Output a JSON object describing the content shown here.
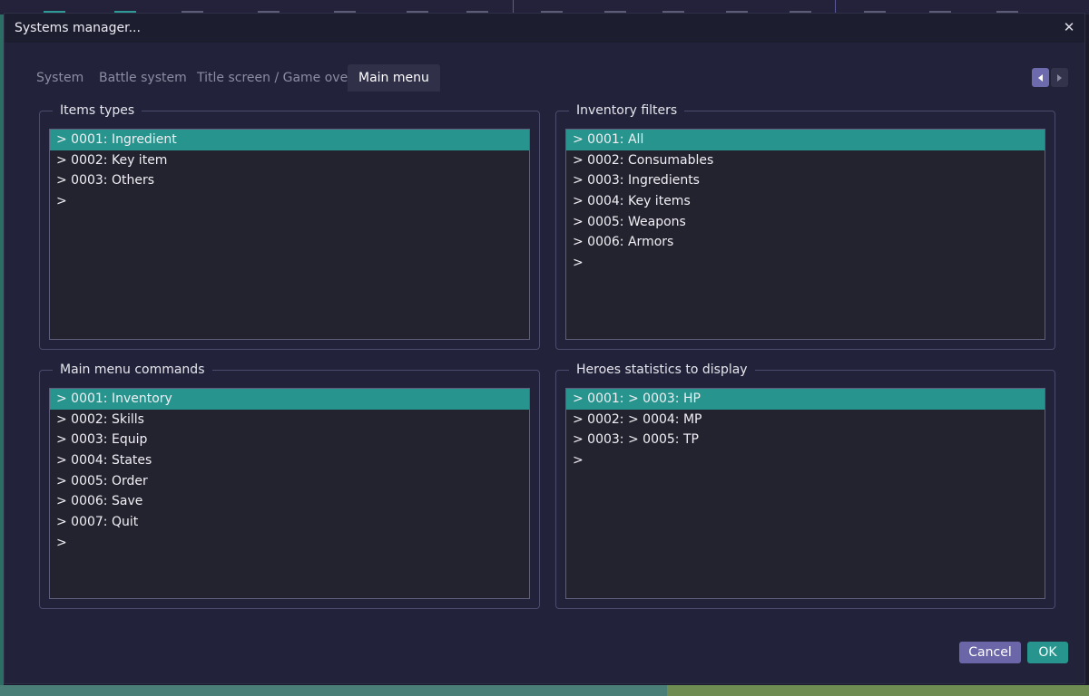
{
  "dialog": {
    "title": "Systems manager..."
  },
  "tabs": [
    {
      "label": "System",
      "active": false
    },
    {
      "label": "Battle system",
      "active": false
    },
    {
      "label": "Title screen / Game over",
      "active": false
    },
    {
      "label": "Main menu",
      "active": true
    }
  ],
  "groups": {
    "items_types": {
      "title": "Items types",
      "items": [
        "> 0001: Ingredient",
        "> 0002: Key item",
        "> 0003: Others",
        ">"
      ],
      "selected_index": 0
    },
    "inventory_filters": {
      "title": "Inventory filters",
      "items": [
        "> 0001: All",
        "> 0002: Consumables",
        "> 0003: Ingredients",
        "> 0004: Key items",
        "> 0005: Weapons",
        "> 0006: Armors",
        ">"
      ],
      "selected_index": 0
    },
    "main_menu_commands": {
      "title": "Main menu commands",
      "items": [
        "> 0001: Inventory",
        "> 0002: Skills",
        "> 0003: Equip",
        "> 0004: States",
        "> 0005: Order",
        "> 0006: Save",
        "> 0007: Quit",
        ">"
      ],
      "selected_index": 0
    },
    "heroes_statistics": {
      "title": "Heroes statistics to display",
      "items": [
        "> 0001: > 0003: HP",
        "> 0002: > 0004: MP",
        "> 0003: > 0005: TP",
        ">"
      ],
      "selected_index": 0
    }
  },
  "buttons": {
    "cancel": "Cancel",
    "ok": "OK"
  },
  "colors": {
    "accent_teal": "#27948d",
    "accent_purple": "#6b66a8",
    "dialog_bg": "#22223a"
  },
  "icons": {
    "close": "close-icon",
    "tab_prev": "chevron-left-icon",
    "tab_next": "chevron-right-icon"
  }
}
